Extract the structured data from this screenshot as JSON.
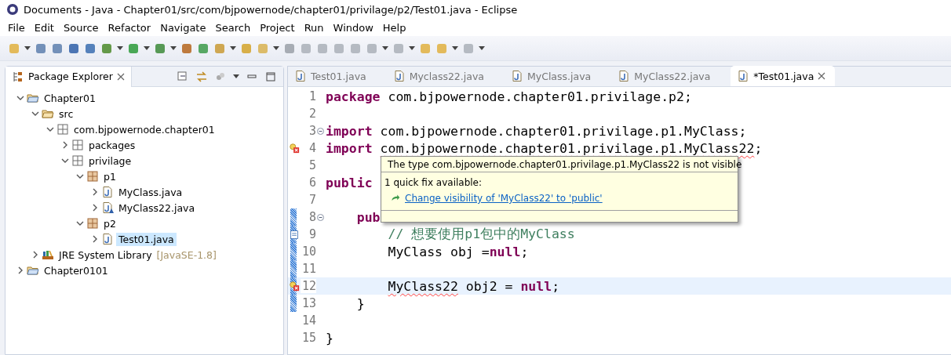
{
  "window": {
    "title": "Documents - Java - Chapter01/src/com/bjpowernode/chapter01/privilage/p2/Test01.java - Eclipse"
  },
  "menu": [
    "File",
    "Edit",
    "Source",
    "Refactor",
    "Navigate",
    "Search",
    "Project",
    "Run",
    "Window",
    "Help"
  ],
  "package_explorer": {
    "title": "Package Explorer",
    "tree": [
      {
        "label": "Chapter01",
        "kind": "project",
        "expanded": true,
        "selected": false,
        "children": [
          {
            "label": "src",
            "kind": "source-folder",
            "expanded": true,
            "selected": false,
            "children": [
              {
                "label": "com.bjpowernode.chapter01",
                "kind": "package",
                "expanded": true,
                "selected": false,
                "children": [
                  {
                    "label": "packages",
                    "kind": "package",
                    "expanded": false,
                    "selected": false
                  },
                  {
                    "label": "privilage",
                    "kind": "package",
                    "expanded": true,
                    "selected": false,
                    "children": [
                      {
                        "label": "p1",
                        "kind": "package-filled",
                        "expanded": true,
                        "selected": false,
                        "children": [
                          {
                            "label": "MyClass.java",
                            "kind": "java-file",
                            "expanded": false,
                            "selected": false
                          },
                          {
                            "label": "MyClass22.java",
                            "kind": "java-file-warning",
                            "expanded": false,
                            "selected": false
                          }
                        ]
                      },
                      {
                        "label": "p2",
                        "kind": "package-filled",
                        "expanded": true,
                        "selected": false,
                        "children": [
                          {
                            "label": "Test01.java",
                            "kind": "java-file",
                            "expanded": false,
                            "selected": true
                          }
                        ]
                      }
                    ]
                  }
                ]
              }
            ]
          },
          {
            "label": "JRE System Library",
            "suffix": "[JavaSE-1.8]",
            "kind": "library",
            "expanded": false,
            "selected": false
          }
        ]
      },
      {
        "label": "Chapter0101",
        "kind": "project",
        "expanded": false,
        "selected": false
      }
    ]
  },
  "editor": {
    "tabs": [
      {
        "label": "Test01.java",
        "selected": false
      },
      {
        "label": "Myclass22.java",
        "selected": false
      },
      {
        "label": "MyClass.java",
        "selected": false
      },
      {
        "label": "MyClass22.java",
        "selected": false
      },
      {
        "label": "*Test01.java",
        "selected": true
      }
    ],
    "lines": [
      {
        "number": "1",
        "tokens": [
          {
            "kind": "keyword",
            "text": "package"
          },
          {
            "kind": "plain",
            "text": " com.bjpowernode.chapter01.privilage.p2;"
          }
        ]
      },
      {
        "number": "2"
      },
      {
        "number": "3",
        "foldable": true,
        "tokens": [
          {
            "kind": "keyword",
            "text": "import"
          },
          {
            "kind": "plain",
            "text": " com.bjpowernode.chapter01.privilage.p1.MyClass;"
          }
        ]
      },
      {
        "number": "4",
        "problem": true,
        "tokens": [
          {
            "kind": "keyword",
            "text": "import"
          },
          {
            "kind": "error",
            "text": " com.bjpowernode.chapter01.privilage.p1.MyClass22"
          },
          {
            "kind": "plain",
            "text": ";"
          }
        ]
      },
      {
        "number": "5"
      },
      {
        "number": "6",
        "tokens": [
          {
            "kind": "keyword",
            "text": "public"
          }
        ]
      },
      {
        "number": "7"
      },
      {
        "number": "8",
        "changed": true,
        "foldable": true,
        "tokens": [
          {
            "kind": "keyword",
            "text": "    pub"
          }
        ]
      },
      {
        "number": "9",
        "changed": true,
        "task": true,
        "tokens": [
          {
            "kind": "comment",
            "text": "        // 想要使用p1包中的MyClass"
          }
        ]
      },
      {
        "number": "10",
        "changed": true,
        "tokens": [
          {
            "kind": "plain",
            "text": "        MyClass obj ="
          },
          {
            "kind": "keyword",
            "text": "null"
          },
          {
            "kind": "plain",
            "text": ";"
          }
        ]
      },
      {
        "number": "11",
        "changed": true
      },
      {
        "number": "12",
        "changed": true,
        "current": true,
        "problem": true,
        "tokens": [
          {
            "kind": "error",
            "text": "        MyClass22"
          },
          {
            "kind": "plain",
            "text": " obj2 = "
          },
          {
            "kind": "keyword",
            "text": "null"
          },
          {
            "kind": "plain",
            "text": ";"
          }
        ]
      },
      {
        "number": "13",
        "changed": true,
        "tokens": [
          {
            "kind": "plain",
            "text": "    }"
          }
        ]
      },
      {
        "number": "14"
      },
      {
        "number": "15",
        "tokens": [
          {
            "kind": "plain",
            "text": "}"
          }
        ]
      }
    ],
    "quick_fix": {
      "problem": "The type com.bjpowernode.chapter01.privilage.p1.MyClass22 is not visible",
      "count": "1 quick fix available:",
      "fixes": [
        "Change visibility of 'MyClass22' to 'public'"
      ]
    }
  }
}
